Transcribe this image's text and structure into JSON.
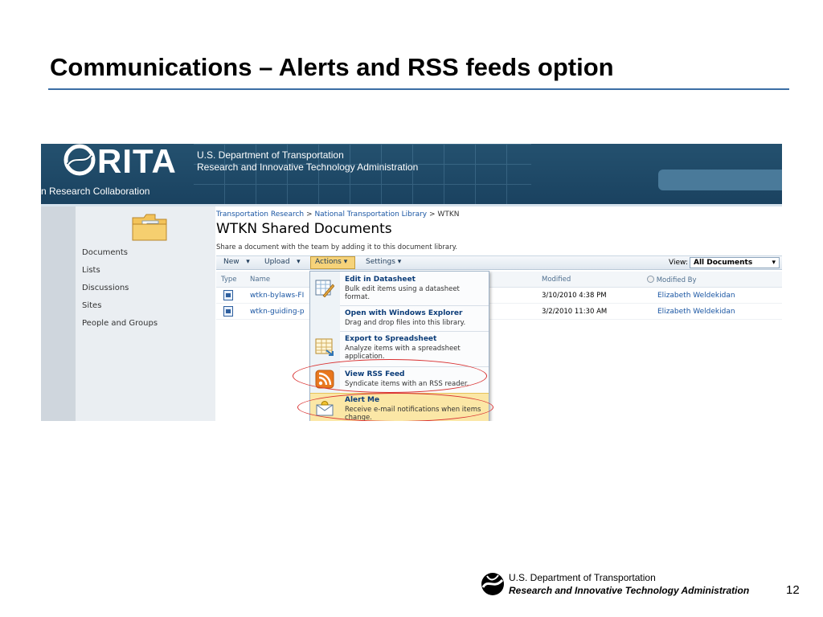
{
  "slide": {
    "title": "Communications – Alerts and RSS feeds option",
    "page_number": "12"
  },
  "footer": {
    "line1": "U.S. Department of Transportation",
    "line2": "Research and Innovative Technology Administration"
  },
  "header": {
    "logo_text": "RITA",
    "dept_line1": "U.S. Department of Transportation",
    "dept_line2": "Research and Innovative Technology Administration",
    "site_name": "n Research Collaboration"
  },
  "nav": {
    "items": [
      {
        "label": "Documents"
      },
      {
        "label": "Lists"
      },
      {
        "label": "Discussions"
      },
      {
        "label": "Sites"
      },
      {
        "label": "People and Groups"
      }
    ]
  },
  "breadcrumb": {
    "items": [
      "Transportation Research",
      "National Transportation Library",
      "WTKN"
    ],
    "sep": ">"
  },
  "library": {
    "title": "WTKN Shared Documents",
    "description": "Share a document with the team by adding it to this document library."
  },
  "toolbar": {
    "new": "New",
    "upload": "Upload",
    "actions": "Actions",
    "settings": "Settings",
    "view_label": "View:",
    "view_value": "All Documents"
  },
  "columns": {
    "type": "Type",
    "name": "Name",
    "modified": "Modified",
    "modified_by": "Modified By"
  },
  "rows": [
    {
      "name": "wtkn-bylaws-FI",
      "modified": "3/10/2010 4:38 PM",
      "modified_by": "Elizabeth Weldekidan"
    },
    {
      "name": "wtkn-guiding-p",
      "modified": "3/2/2010 11:30 AM",
      "modified_by": "Elizabeth Weldekidan"
    }
  ],
  "actions_menu": [
    {
      "title": "Edit in Datasheet",
      "desc": "Bulk edit items using a datasheet format.",
      "icon": "datasheet-icon"
    },
    {
      "title": "Open with Windows Explorer",
      "desc": "Drag and drop files into this library.",
      "icon": "explorer-icon"
    },
    {
      "title": "Export to Spreadsheet",
      "desc": "Analyze items with a spreadsheet application.",
      "icon": "spreadsheet-icon"
    },
    {
      "title": "View RSS Feed",
      "desc": "Syndicate items with an RSS reader.",
      "icon": "rss-icon"
    },
    {
      "title": "Alert Me",
      "desc": "Receive e-mail notifications when items change.",
      "icon": "alert-icon"
    }
  ],
  "colors": {
    "accent_rule": "#3b6ea5",
    "header_bg": "#1d4662",
    "link": "#1a56a3",
    "highlight": "#fbe7a6",
    "annotation": "#d93030"
  }
}
